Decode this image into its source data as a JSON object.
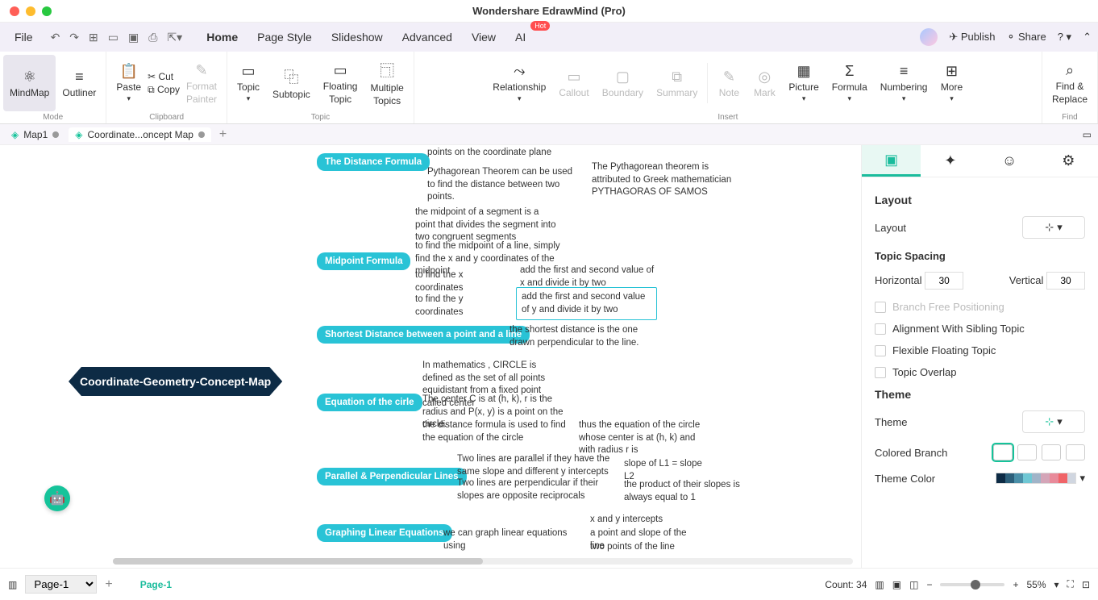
{
  "app_title": "Wondershare EdrawMind (Pro)",
  "menubar": {
    "file": "File",
    "items": [
      "Home",
      "Page Style",
      "Slideshow",
      "Advanced",
      "View",
      "AI"
    ],
    "publish": "Publish",
    "share": "Share"
  },
  "ribbon": {
    "mode": {
      "label": "Mode",
      "mindmap": "MindMap",
      "outliner": "Outliner"
    },
    "clipboard": {
      "label": "Clipboard",
      "paste": "Paste",
      "cut": "Cut",
      "copy": "Copy",
      "fp1": "Format",
      "fp2": "Painter"
    },
    "topic": {
      "label": "Topic",
      "topic": "Topic",
      "subtopic": "Subtopic",
      "ft1": "Floating",
      "ft2": "Topic",
      "mt1": "Multiple",
      "mt2": "Topics"
    },
    "insert": {
      "label": "Insert",
      "relationship": "Relationship",
      "callout": "Callout",
      "boundary": "Boundary",
      "summary": "Summary",
      "note": "Note",
      "mark": "Mark",
      "picture": "Picture",
      "formula": "Formula",
      "numbering": "Numbering",
      "more": "More"
    },
    "find": {
      "label": "Find",
      "fr1": "Find &",
      "fr2": "Replace"
    }
  },
  "tabs": {
    "t1": "Map1",
    "t2": "Coordinate...oncept Map"
  },
  "mindmap": {
    "root": "Coordinate-Geometry-Concept-Map",
    "t1": "The Distance Formula",
    "t1s1": "points on the coordinate plane",
    "t1s2": "Pythagorean Theorem can be used to find the distance between two points.",
    "t1s2a": "The Pythagorean theorem is attributed to Greek mathematician PYTHAGORAS OF SAMOS",
    "t2": "Midpoint Formula",
    "t2s1": "the midpoint of a segment is a point that divides the segment into two congruent segments",
    "t2s2": "to find the midpoint of a line, simply find the x  and y coordinates of the midpoint",
    "t2s3": "to find the x coordinates",
    "t2s3a": "add the first and second value of x and divide it by two",
    "t2s4": "to find the y coordinates",
    "t2s4a": "add the first and second value of y and divide it by two",
    "t3": "Shortest Distance between a point and a line",
    "t3s1": "the shortest distance is the one drawn perpendicular to the line.",
    "t4": "Equation of the cirle",
    "t4s1": "In mathematics , CIRCLE is defined as the set of all points equidistant from a fixed point called center",
    "t4s2": "The center C is at (h, k), r is the radius and P(x, y) is a point on the circle.",
    "t4s3": "the distance formula is used to find the equation of the circle",
    "t4s3a": "thus the equation of the circle whose center is at (h, k) and with radius r is",
    "t5": "Parallel & Perpendicular Lines",
    "t5s1": "Two lines are parallel if they have the same slope and different y  intercepts",
    "t5s1a": "slope of L1 = slope L2",
    "t5s2": "Two lines are perpendicular if their slopes are opposite reciprocals",
    "t5s2a": "the product of their slopes is always equal to 1",
    "t6": "Graphing Linear Equations",
    "t6s1": "we can graph linear equations using",
    "t6s1a": "x  and y intercepts",
    "t6s1b": "a point and slope of the line",
    "t6s1c": "two points of the line"
  },
  "panel": {
    "layout_h": "Layout",
    "layout_l": "Layout",
    "spacing_h": "Topic Spacing",
    "horiz": "Horizontal",
    "horiz_v": "30",
    "vert": "Vertical",
    "vert_v": "30",
    "c1": "Branch Free Positioning",
    "c2": "Alignment With Sibling Topic",
    "c3": "Flexible Floating Topic",
    "c4": "Topic Overlap",
    "theme_h": "Theme",
    "theme_l": "Theme",
    "cb": "Colored Branch",
    "tc": "Theme Color"
  },
  "status": {
    "pagesel": "Page-1",
    "pagetab": "Page-1",
    "count": "Count: 34",
    "zoom": "55%"
  }
}
